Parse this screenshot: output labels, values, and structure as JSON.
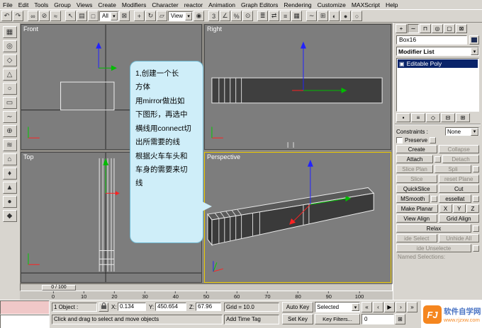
{
  "icons": {
    "dropdown": "▾",
    "cube": "▣",
    "time_config": "⊞"
  },
  "menu": {
    "items": [
      "File",
      "Edit",
      "Tools",
      "Group",
      "Views",
      "Create",
      "Modifiers",
      "Character",
      "reactor",
      "Animation",
      "Graph Editors",
      "Rendering",
      "Customize",
      "MAXScript",
      "Help"
    ]
  },
  "toolbar": {
    "items": [
      {
        "t": "icon",
        "name": "undo-icon",
        "g": "↶"
      },
      {
        "t": "icon",
        "name": "redo-icon",
        "g": "↷"
      },
      {
        "t": "sep"
      },
      {
        "t": "icon",
        "name": "select-and-link-icon",
        "g": "∞"
      },
      {
        "t": "icon",
        "name": "unlink-selection-icon",
        "g": "⊘"
      },
      {
        "t": "icon",
        "name": "bind-to-spacewarp-icon",
        "g": "≈"
      },
      {
        "t": "sep"
      },
      {
        "t": "icon",
        "name": "select-object-icon",
        "g": "↖"
      },
      {
        "t": "icon",
        "name": "select-by-name-icon",
        "g": "▤"
      },
      {
        "t": "icon",
        "name": "selection-region-icon",
        "g": "□"
      },
      {
        "t": "drop",
        "name": "selection-filter-dropdown",
        "label": "All"
      },
      {
        "t": "icon",
        "name": "window-crossing-icon",
        "g": "⊠"
      },
      {
        "t": "sep"
      },
      {
        "t": "icon",
        "name": "select-and-move-icon",
        "g": "+"
      },
      {
        "t": "icon",
        "name": "select-and-rotate-icon",
        "g": "↻"
      },
      {
        "t": "icon",
        "name": "select-and-scale-icon",
        "g": "▱"
      },
      {
        "t": "drop",
        "name": "reference-coordinate-dropdown",
        "label": "View"
      },
      {
        "t": "icon",
        "name": "use-pivot-point-icon",
        "g": "◉"
      },
      {
        "t": "sep"
      },
      {
        "t": "icon",
        "name": "snap-toggle-icon",
        "g": "3"
      },
      {
        "t": "icon",
        "name": "angle-snap-icon",
        "g": "∠"
      },
      {
        "t": "icon",
        "name": "percent-snap-icon",
        "g": "%"
      },
      {
        "t": "icon",
        "name": "spinner-snap-icon",
        "g": "⊙"
      },
      {
        "t": "sep"
      },
      {
        "t": "icon",
        "name": "named-selection-sets-icon",
        "g": "≣"
      },
      {
        "t": "icon",
        "name": "mirror-icon",
        "g": "⇄"
      },
      {
        "t": "icon",
        "name": "align-icon",
        "g": "≡"
      },
      {
        "t": "icon",
        "name": "layer-manager-icon",
        "g": "▦"
      },
      {
        "t": "sep"
      },
      {
        "t": "icon",
        "name": "curve-editor-icon",
        "g": "∼"
      },
      {
        "t": "icon",
        "name": "schematic-view-icon",
        "g": "⊞"
      },
      {
        "t": "icon",
        "name": "material-editor-icon",
        "g": "◐"
      },
      {
        "t": "icon",
        "name": "render-scene-icon",
        "g": "●"
      },
      {
        "t": "icon",
        "name": "quick-render-icon",
        "g": "○"
      }
    ]
  },
  "left_toolbar": {
    "icons": [
      "▦",
      "◎",
      "◇",
      "△",
      "○",
      "▭",
      "∼",
      "⊕",
      "≋",
      "⌂",
      "♦",
      "▲",
      "●",
      "◆"
    ]
  },
  "viewports": {
    "front": "Front",
    "right": "Right",
    "top": "Top",
    "perspective": "Perspective"
  },
  "callout": {
    "text": "1,创建一个长\n方体\n用mirror做出如\n下图形，再选中\n横线用connect切\n出所需要的线\n根据火车车头和\n车身的需要来切\n线"
  },
  "panel": {
    "tabs": [
      {
        "name": "tab-create",
        "g": "+"
      },
      {
        "name": "tab-modify",
        "g": "∼",
        "active": true
      },
      {
        "name": "tab-hierarchy",
        "g": "⊓"
      },
      {
        "name": "tab-motion",
        "g": "◎"
      },
      {
        "name": "tab-display",
        "g": "▢"
      },
      {
        "name": "tab-utilities",
        "g": "⊠"
      }
    ],
    "object_name": "Box16",
    "modifier_list": "Modifier List",
    "stack_item": "Editable Poly",
    "stack_tools": [
      {
        "name": "pin-stack-button",
        "g": "▪"
      },
      {
        "name": "show-end-result-button",
        "g": "≡"
      },
      {
        "name": "make-unique-button",
        "g": "◇"
      },
      {
        "name": "remove-modifier-button",
        "g": "⊟"
      },
      {
        "name": "configure-modifier-button",
        "g": "⊞"
      }
    ],
    "constraints_label": "Constraints :",
    "constraints_value": "None",
    "preserve_label": "Preserve",
    "edit_rows": [
      [
        {
          "label": "Create",
          "name": "create-button"
        },
        {
          "label": "Collapse",
          "name": "collapse-button",
          "disabled": true
        }
      ],
      [
        {
          "label": "Attach",
          "name": "attach-button",
          "settings": true
        },
        {
          "label": "Detach",
          "name": "detach-button",
          "disabled": true
        }
      ],
      [
        {
          "label": "Slice Plan",
          "name": "slice-plane-button",
          "disabled": true
        },
        {
          "label": "Spli",
          "name": "split-button",
          "disabled": true,
          "settings": true
        }
      ],
      [
        {
          "label": "Slice",
          "name": "slice-button",
          "disabled": true
        },
        {
          "label": "reset Plane",
          "name": "reset-plane-button",
          "disabled": true
        }
      ],
      [
        {
          "label": "QuickSlice",
          "name": "quickslice-button"
        },
        {
          "label": "Cut",
          "name": "cut-button"
        }
      ],
      [
        {
          "label": "MSmooth",
          "name": "msmooth-button",
          "settings": true
        },
        {
          "label": "essellat",
          "name": "tessellate-button",
          "settings": true
        }
      ],
      [
        {
          "label": "Make Planar",
          "name": "make-planar-button"
        },
        {
          "xyz": [
            "X",
            "Y",
            "Z"
          ]
        }
      ],
      [
        {
          "label": "View Align",
          "name": "view-align-button"
        },
        {
          "label": "Grid Align",
          "name": "grid-align-button"
        }
      ],
      [
        {
          "label": "Relax",
          "name": "relax-button",
          "settings": true
        }
      ],
      [
        {
          "label": "ide Select",
          "name": "hide-selected-button",
          "disabled": true
        },
        {
          "label": "Unhide All",
          "name": "unhide-all-button",
          "disabled": true
        }
      ],
      [
        {
          "label": "ide Unselecte",
          "name": "hide-unselected-button",
          "disabled": true,
          "settings": true
        }
      ],
      [
        {
          "label": "Named Selections:",
          "name": "named-selections-label",
          "flat": true,
          "disabled": true
        }
      ]
    ]
  },
  "timeline": {
    "slider": "0 / 100",
    "ticks": [
      "0",
      "10",
      "20",
      "30",
      "40",
      "50",
      "60",
      "70",
      "80",
      "90",
      "100"
    ]
  },
  "status": {
    "objects": "1 Object : ",
    "x_label": "X:",
    "x": "0.134",
    "y_label": "Y:",
    "y": "450.654",
    "z_label": "Z:",
    "z": "67.96",
    "grid": "Grid = 10.0",
    "prompt": "Click and drag to select and move objects",
    "time_tag": "Add Time Tag",
    "autokey": "Auto Key",
    "selected": "Selected",
    "setkey": "Set Key",
    "key_filters": "Key Filters...",
    "time_value": "0",
    "playback": [
      {
        "name": "go-to-start-button",
        "g": "«"
      },
      {
        "name": "previous-frame-button",
        "g": "‹"
      },
      {
        "name": "play-button",
        "g": "▶"
      },
      {
        "name": "next-frame-button",
        "g": "›"
      },
      {
        "name": "go-to-end-button",
        "g": "»"
      }
    ]
  },
  "watermark": {
    "logo": "FJ",
    "brand": "软件自学网",
    "url": "www.rjzxw.com"
  },
  "colors": {
    "active_viewport_border": "#e8c800",
    "bubble_bg": "#cfeef9",
    "stack_highlight": "#0a246a",
    "logo_orange": "#f5861f",
    "brand_blue": "#4a74c4"
  }
}
